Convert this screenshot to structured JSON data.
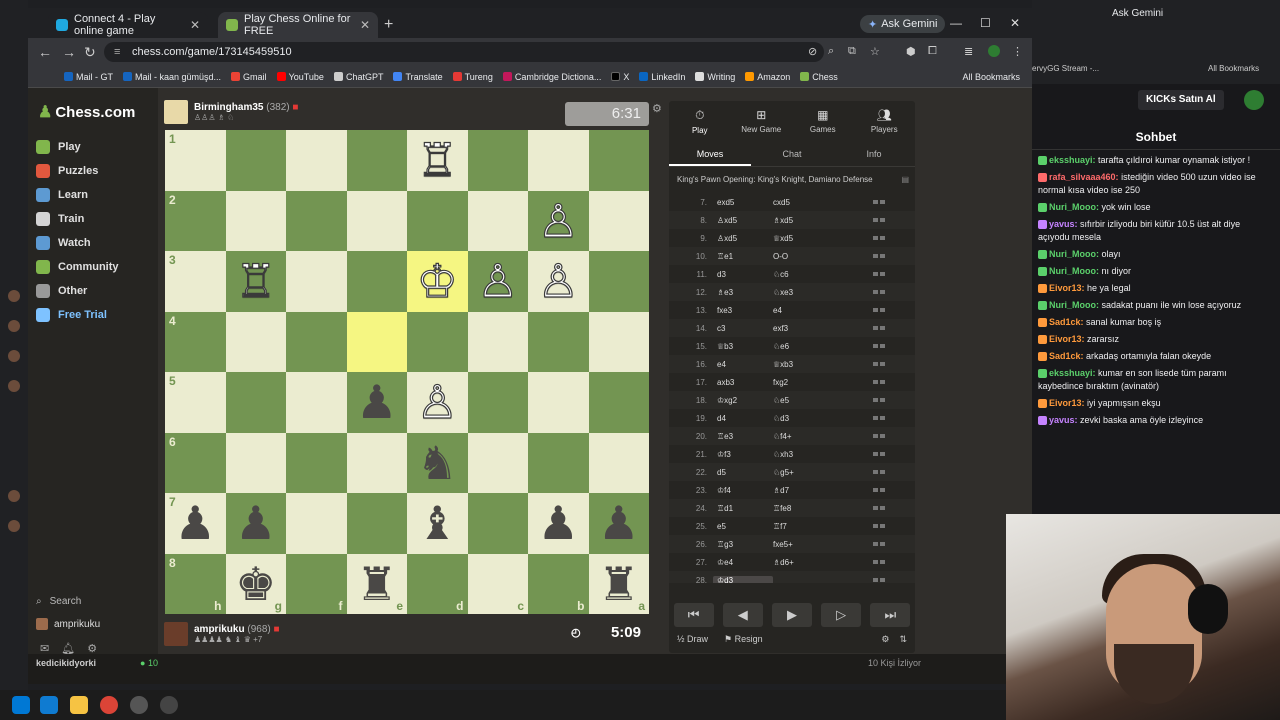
{
  "browser": {
    "tabs": [
      {
        "title": "Connect 4 - Play online game"
      },
      {
        "title": "Play Chess Online for FREE"
      }
    ],
    "ask_gemini": "Ask Gemini",
    "url": "chess.com/game/173145459510",
    "bookmarks": [
      "Mail - GT",
      "Mail - kaan gümüşd...",
      "Gmail",
      "YouTube",
      "ChatGPT",
      "Translate",
      "Tureng",
      "Cambridge Dictiona...",
      "X",
      "LinkedIn",
      "Writing",
      "Amazon",
      "Chess"
    ],
    "all_bookmarks": "All Bookmarks"
  },
  "sidebar": {
    "logo": "Chess.com",
    "items": [
      {
        "label": "Play",
        "color": "#81b64c"
      },
      {
        "label": "Puzzles",
        "color": "#e2583e"
      },
      {
        "label": "Learn",
        "color": "#5d9ad2"
      },
      {
        "label": "Train",
        "color": "#d4d4d4"
      },
      {
        "label": "Watch",
        "color": "#5d9ad2"
      },
      {
        "label": "Community",
        "color": "#81b64c"
      },
      {
        "label": "Other",
        "color": "#999999"
      },
      {
        "label": "Free Trial",
        "color": "#7ec2ff"
      }
    ],
    "search": "Search",
    "username": "amprikuku"
  },
  "game": {
    "top_player": {
      "name": "Birmingham35",
      "rating": "(382)"
    },
    "bottom_player": {
      "name": "amprikuku",
      "rating": "(968)",
      "advantage": "+7"
    },
    "clock_top": "6:31",
    "clock_bottom": "5:09",
    "board": [
      [
        "",
        "",
        "",
        "",
        "wR",
        "",
        "",
        ""
      ],
      [
        "",
        "",
        "",
        "",
        "",
        "",
        "wP",
        ""
      ],
      [
        "",
        "wR",
        "",
        "",
        "wK",
        "wP",
        "wP",
        ""
      ],
      [
        "",
        "",
        "",
        "",
        "",
        "",
        "",
        ""
      ],
      [
        "",
        "",
        "",
        "bP",
        "wP",
        "",
        "",
        ""
      ],
      [
        "",
        "",
        "",
        "",
        "bN",
        "",
        "",
        ""
      ],
      [
        "bP",
        "bP",
        "",
        "",
        "bB",
        "",
        "bP",
        "bP"
      ],
      [
        "",
        "bK",
        "",
        "bR",
        "",
        "",
        "",
        "bR"
      ]
    ],
    "rank_labels": [
      "1",
      "2",
      "3",
      "4",
      "5",
      "6",
      "7",
      "8"
    ],
    "file_labels": [
      "h",
      "g",
      "f",
      "e",
      "d",
      "c",
      "b",
      "a"
    ],
    "highlight_squares": [
      [
        2,
        4
      ],
      [
        3,
        3
      ]
    ]
  },
  "panel": {
    "nav": [
      "Play",
      "New Game",
      "Games",
      "Players"
    ],
    "tabs": [
      "Moves",
      "Chat",
      "Info"
    ],
    "opening": "King's Pawn Opening: King's Knight, Damiano Defense",
    "moves": [
      {
        "n": "7.",
        "w": "exd5",
        "b": "cxd5"
      },
      {
        "n": "8.",
        "w": "♙xd5",
        "b": "♗xd5"
      },
      {
        "n": "9.",
        "w": "♙xd5",
        "b": "♕xd5"
      },
      {
        "n": "10.",
        "w": "♖e1",
        "b": "O-O"
      },
      {
        "n": "11.",
        "w": "d3",
        "b": "♘c6"
      },
      {
        "n": "12.",
        "w": "♗e3",
        "b": "♘xe3"
      },
      {
        "n": "13.",
        "w": "fxe3",
        "b": "e4"
      },
      {
        "n": "14.",
        "w": "c3",
        "b": "exf3"
      },
      {
        "n": "15.",
        "w": "♕b3",
        "b": "♘e6"
      },
      {
        "n": "16.",
        "w": "e4",
        "b": "♕xb3"
      },
      {
        "n": "17.",
        "w": "axb3",
        "b": "fxg2"
      },
      {
        "n": "18.",
        "w": "♔xg2",
        "b": "♘e5"
      },
      {
        "n": "19.",
        "w": "d4",
        "b": "♘d3"
      },
      {
        "n": "20.",
        "w": "♖e3",
        "b": "♘f4+"
      },
      {
        "n": "21.",
        "w": "♔f3",
        "b": "♘xh3"
      },
      {
        "n": "22.",
        "w": "d5",
        "b": "♘g5+"
      },
      {
        "n": "23.",
        "w": "♔f4",
        "b": "♗d7"
      },
      {
        "n": "24.",
        "w": "♖d1",
        "b": "♖fe8"
      },
      {
        "n": "25.",
        "w": "e5",
        "b": "♖f7"
      },
      {
        "n": "26.",
        "w": "♖g3",
        "b": "fxe5+"
      },
      {
        "n": "27.",
        "w": "♔e4",
        "b": "♗d6+"
      },
      {
        "n": "28.",
        "w": "♔d3",
        "b": ""
      }
    ],
    "draw": "Draw",
    "resign": "Resign"
  },
  "chat": {
    "ask_gemini": "Ask Gemini",
    "stream_tab": "ervyGG Stream -...",
    "all_bookmarks": "All Bookmarks",
    "kick_button": "KICKs Satın Al",
    "header": "Sohbet",
    "messages": [
      {
        "user": "eksshuayi:",
        "text": "tarafta çıldıroi kumar oynamak istiyor !",
        "color": "#5bd06b"
      },
      {
        "user": "rafa_silvaaa460:",
        "text": "istediğin video 500 uzun video ise normal kısa video ise 250",
        "color": "#ff6b6b"
      },
      {
        "user": "Nuri_Mooo:",
        "text": "yok win lose",
        "color": "#5bd06b"
      },
      {
        "user": "yavus:",
        "text": "sıfırbir izliyodu biri küfür 10.5 üst alt diye açıyodu mesela",
        "color": "#c583ff"
      },
      {
        "user": "Nuri_Mooo:",
        "text": "olayı",
        "color": "#5bd06b"
      },
      {
        "user": "Nuri_Mooo:",
        "text": "nı diyor",
        "color": "#5bd06b"
      },
      {
        "user": "Eivor13:",
        "text": "he ya legal",
        "color": "#ff9a3c"
      },
      {
        "user": "Nuri_Mooo:",
        "text": "sadakat puanı ile win lose açıyoruz",
        "color": "#5bd06b"
      },
      {
        "user": "Sad1ck:",
        "text": "sanal kumar boş iş",
        "color": "#ff9a3c"
      },
      {
        "user": "Eivor13:",
        "text": "zararsız",
        "color": "#ff9a3c"
      },
      {
        "user": "Sad1ck:",
        "text": "arkadaş ortamıyla falan okeyde",
        "color": "#ff9a3c"
      },
      {
        "user": "eksshuayi:",
        "text": "kumar en son lisede tüm paramı kaybedince bıraktım (avinatör)",
        "color": "#5bd06b"
      },
      {
        "user": "Eivor13:",
        "text": "iyi yapmışsın ekşu",
        "color": "#ff9a3c"
      },
      {
        "user": "yavus:",
        "text": "zevki baska ama öyle izleyince",
        "color": "#c583ff"
      }
    ]
  },
  "below": {
    "channel": "kedicikidyorki",
    "viewers": "10",
    "watching": "10 Kişi İzliyor"
  }
}
